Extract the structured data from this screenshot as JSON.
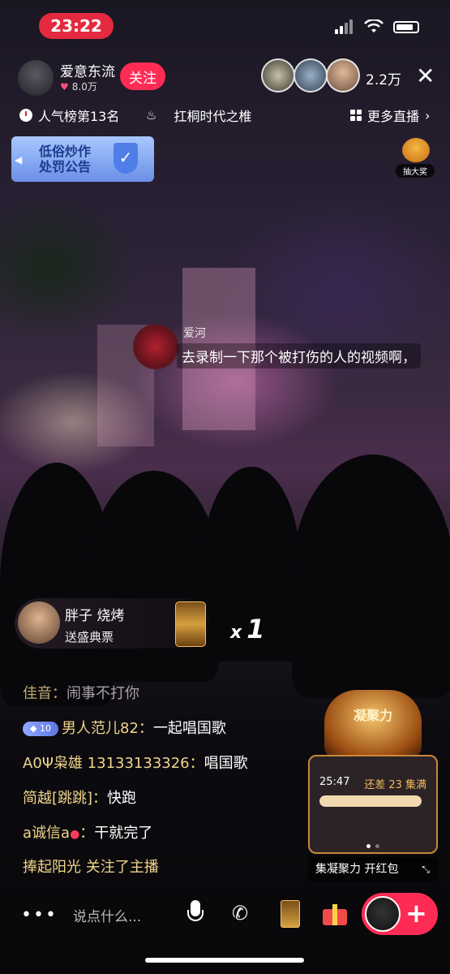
{
  "status_bar": {
    "time": "23:22"
  },
  "host": {
    "name": "爱意东流",
    "likes": "8.0万",
    "follow_label": "关注"
  },
  "viewers": {
    "count": "2.2万"
  },
  "info_row": {
    "rank": "人气榜第13名",
    "hot_topic": "扛桐时代之椎",
    "more_live": "更多直播"
  },
  "notice": {
    "line1": "低俗炒作",
    "line2": "处罚公告"
  },
  "lottery": {
    "label": "抽大奖"
  },
  "floating_comment": {
    "user": "爱河",
    "text": "去录制一下那个被打伤的人的视频啊，"
  },
  "gift": {
    "user": "胖子 烧烤",
    "action": "送盛典票",
    "count_prefix": "x",
    "count": "1"
  },
  "chat": [
    {
      "user": "佳音：",
      "text": "闹事不打你"
    },
    {
      "badge": "10",
      "user": "男人范儿82：",
      "text": "一起唱国歌"
    },
    {
      "user_prefix": "A0",
      "user_icon": "trident",
      "user_suffix": "枭雄",
      "user_extra": " 13133133326：",
      "text": "唱国歌"
    },
    {
      "user": "简越[跳跳]：",
      "text": "快跑"
    },
    {
      "user": "a诚信a",
      "user_icon": "kiss",
      "user_suffix": "：",
      "text": "干就完了"
    },
    {
      "user": "捧起阳光",
      "text": " 关注了主播"
    }
  ],
  "energy_widget": {
    "title": "凝聚力",
    "time": "25:47",
    "remaining": "还差 23 集满",
    "progress": 1.0,
    "caption": "集凝聚力 开红包"
  },
  "bottom_bar": {
    "input_placeholder": "说点什么..."
  }
}
